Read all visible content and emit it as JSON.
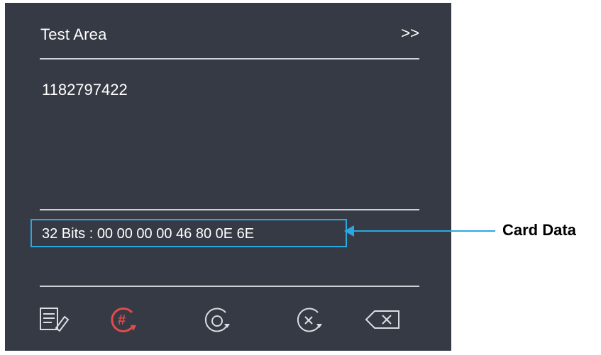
{
  "panel": {
    "title": "Test Area",
    "expand_label": ">>",
    "value": "1182797422",
    "card_data_text": "32 Bits : 00 00 00 00 46 80 0E 6E"
  },
  "toolbar": {
    "icons": [
      "edit-document-icon",
      "hash-refresh-icon",
      "rotate-reset-icon",
      "cancel-rotate-icon",
      "backspace-icon"
    ],
    "active_color": "#e24b4b",
    "icon_color": "#d9dde3"
  },
  "annotation": {
    "label": "Card Data",
    "color": "#2aa9e0"
  }
}
